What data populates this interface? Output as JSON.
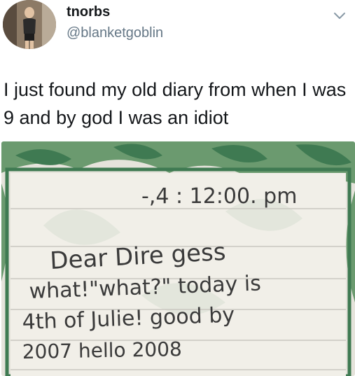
{
  "author": {
    "display_name": "tnorbs",
    "handle": "@blanketgoblin"
  },
  "tweet": {
    "text": "I just found my old diary from when I was 9 and by god I was an idiot"
  },
  "media": {
    "diary_lines": [
      "-,4 :  12:00. pm",
      "Dear Dire gess",
      "what!\"what?\" today is",
      "4th of Julie! good by",
      "2007 hello 2008"
    ]
  },
  "icons": {
    "menu": "chevron-down-icon",
    "avatar": "profile-photo"
  },
  "colors": {
    "name": "#14171a",
    "handle": "#657786",
    "border_green": "#3f7a52",
    "paper": "#f1efe8"
  }
}
